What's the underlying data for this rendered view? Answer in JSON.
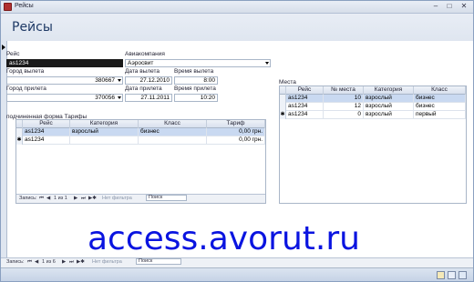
{
  "window": {
    "title": "Рейсы"
  },
  "header": {
    "title": "Рейсы"
  },
  "form": {
    "reys_label": "Рейс",
    "reys_value": "as1234",
    "aviakompaniya_label": "Авиакомпания",
    "aviakompaniya_value": "Аэросвит",
    "gorod_vyleta_label": "Город вылета",
    "gorod_vyleta_value": "380667",
    "data_vyleta_label": "Дата вылета",
    "data_vyleta_value": "27.12.2010",
    "vremya_vyleta_label": "Время вылета",
    "vremya_vyleta_value": "8:00",
    "gorod_prileta_label": "Город прилета",
    "gorod_prileta_value": "370056",
    "data_prileta_label": "Дата прилета",
    "data_prileta_value": "27.11.2011",
    "vremya_prileta_label": "Время прилета",
    "vremya_prileta_value": "10:20"
  },
  "subform": {
    "label": "подчиненная форма Тарифы",
    "columns": [
      "Рейс",
      "Категория",
      "Класс",
      "Тариф"
    ],
    "rows": [
      {
        "reys": "as1234",
        "kategoriya": "взрослый",
        "klass": "бизнес",
        "tarif": "0,00 грн."
      },
      {
        "reys": "as1234",
        "kategoriya": "",
        "klass": "",
        "tarif": "0,00 грн."
      }
    ],
    "nav": {
      "records_label": "Запись:",
      "position": "1 из 1",
      "filter": "Нет фильтра",
      "search": "Поиск"
    }
  },
  "mesta": {
    "label": "Места",
    "columns": [
      "Рейс",
      "№ места",
      "Категория",
      "Класс"
    ],
    "rows": [
      {
        "reys": "as1234",
        "mesto": "10",
        "kategoriya": "взрослый",
        "klass": "бизнес"
      },
      {
        "reys": "as1234",
        "mesto": "12",
        "kategoriya": "взрослый",
        "klass": "бизнес"
      },
      {
        "reys": "as1234",
        "mesto": "0",
        "kategoriya": "взрослый",
        "klass": "первый"
      }
    ]
  },
  "mainnav": {
    "records_label": "Запись:",
    "position": "1 из 6",
    "filter": "Нет фильтра",
    "search": "Поиск"
  },
  "watermark": "access.avorut.ru",
  "colors": {
    "accent": "#1f3a66",
    "selection": "#c9d9f1",
    "watermark": "#0a14e0"
  }
}
